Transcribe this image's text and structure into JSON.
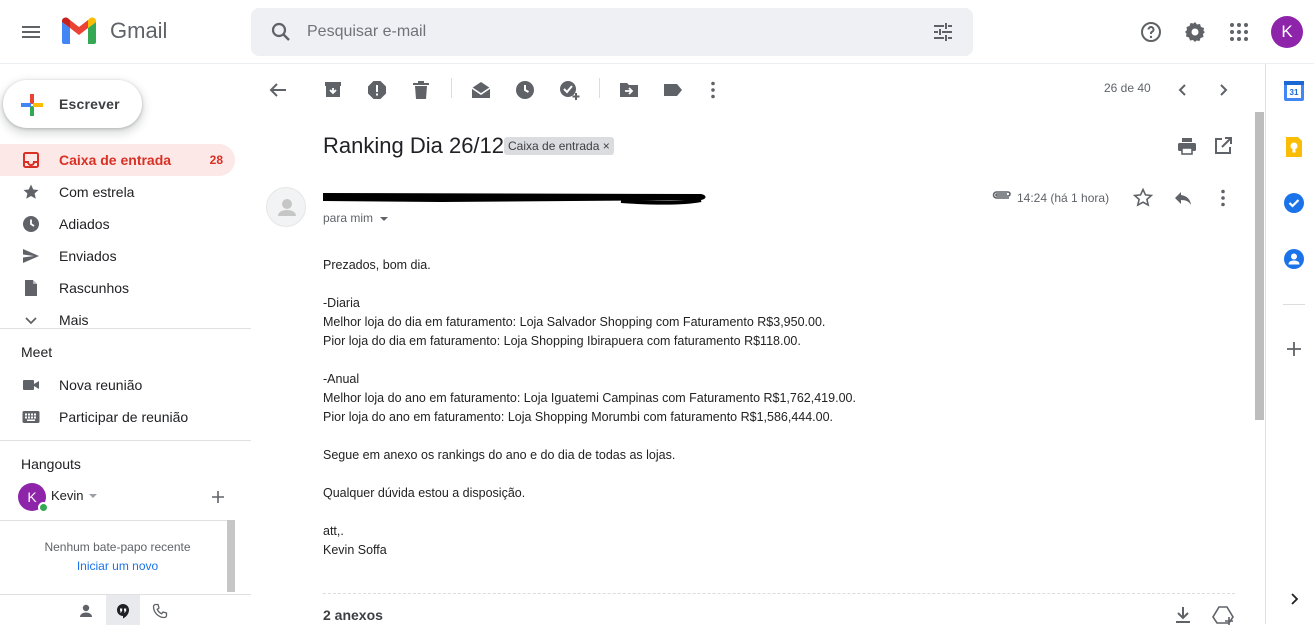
{
  "header": {
    "app_name": "Gmail",
    "search_placeholder": "Pesquisar e-mail",
    "avatar_letter": "K"
  },
  "sidebar": {
    "compose_label": "Escrever",
    "items": [
      {
        "label": "Caixa de entrada",
        "count": "28",
        "icon": "inbox-icon",
        "active": true
      },
      {
        "label": "Com estrela",
        "icon": "star-icon"
      },
      {
        "label": "Adiados",
        "icon": "clock-icon"
      },
      {
        "label": "Enviados",
        "icon": "send-icon"
      },
      {
        "label": "Rascunhos",
        "icon": "draft-icon"
      },
      {
        "label": "Mais",
        "icon": "chevron-down-icon"
      }
    ],
    "meet": {
      "title": "Meet",
      "items": [
        {
          "label": "Nova reunião",
          "icon": "videocam-icon"
        },
        {
          "label": "Participar de reunião",
          "icon": "keyboard-icon"
        }
      ]
    },
    "hangouts": {
      "title": "Hangouts",
      "user_initial": "K",
      "user_name": "Kevin",
      "empty_text": "Nenhum bate-papo recente",
      "start_link": "Iniciar um novo"
    }
  },
  "toolbar": {
    "pager": "26 de 40"
  },
  "email": {
    "subject": "Ranking Dia 26/12",
    "label": "Caixa de entrada",
    "label_close": "×",
    "recipient": "para mim",
    "time": "14:24 (há 1 hora)",
    "body": [
      "Prezados, bom dia.",
      "",
      "-Diaria",
      "Melhor loja do dia em faturamento: Loja Salvador Shopping com Faturamento R$3,950.00.",
      "Pior loja do dia em faturamento: Loja Shopping Ibirapuera com faturamento R$118.00.",
      "",
      "-Anual",
      "Melhor loja do ano em faturamento: Loja Iguatemi Campinas com Faturamento R$1,762,419.00.",
      "Pior loja do ano em faturamento: Loja Shopping Morumbi com faturamento R$1,586,444.00.",
      "",
      "Segue em anexo os rankings do ano e do dia de todas as lojas.",
      "",
      "Qualquer dúvida estou a disposição.",
      "",
      "att,.",
      "Kevin Soffa"
    ],
    "attachments_title": "2 anexos"
  },
  "colors": {
    "accent_red": "#d93025",
    "active_bg": "#fce8e6",
    "avatar_purple": "#8e24aa"
  }
}
